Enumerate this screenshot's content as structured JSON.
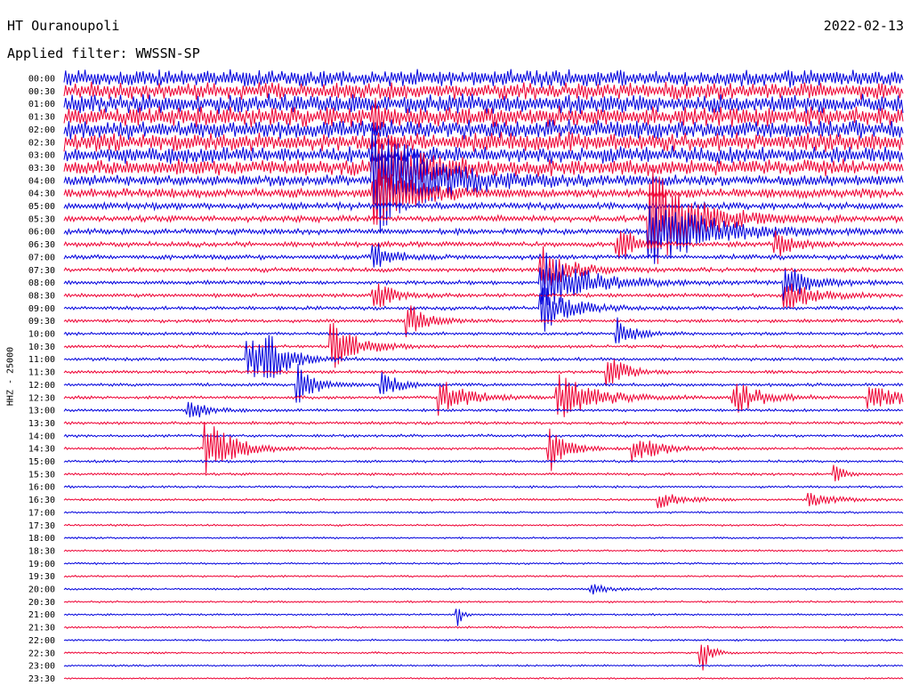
{
  "header": {
    "station": "HT Ouranoupoli",
    "date": "2022-02-13",
    "filter": "Applied filter: WWSSN-SP"
  },
  "channel_label": "HHZ - 25000",
  "colors": {
    "trace_a": "#0000dd",
    "trace_b": "#ee0033"
  },
  "chart_data": {
    "type": "line",
    "title": "HT Ouranoupoli",
    "subtitle": "Applied filter: WWSSN-SP",
    "ylabel": "HHZ - 25000",
    "time_labels": [
      "00:00",
      "00:30",
      "01:00",
      "01:30",
      "02:00",
      "02:30",
      "03:00",
      "03:30",
      "04:00",
      "04:30",
      "05:00",
      "05:30",
      "06:00",
      "06:30",
      "07:00",
      "07:30",
      "08:00",
      "08:30",
      "09:00",
      "09:30",
      "10:00",
      "10:30",
      "11:00",
      "11:30",
      "12:00",
      "12:30",
      "13:00",
      "13:30",
      "14:00",
      "14:30",
      "15:00",
      "15:30",
      "16:00",
      "16:30",
      "17:00",
      "17:30",
      "18:00",
      "18:30",
      "19:00",
      "19:30",
      "20:00",
      "20:30",
      "21:00",
      "21:30",
      "22:00",
      "22:30",
      "23:00",
      "23:30"
    ],
    "noise_level": [
      0.55,
      0.55,
      0.6,
      0.65,
      0.6,
      0.6,
      0.55,
      0.5,
      0.35,
      0.3,
      0.22,
      0.2,
      0.18,
      0.16,
      0.15,
      0.14,
      0.13,
      0.12,
      0.12,
      0.11,
      0.1,
      0.1,
      0.1,
      0.1,
      0.1,
      0.1,
      0.09,
      0.09,
      0.09,
      0.08,
      0.08,
      0.08,
      0.07,
      0.07,
      0.06,
      0.06,
      0.06,
      0.06,
      0.06,
      0.06,
      0.06,
      0.06,
      0.06,
      0.06,
      0.06,
      0.06,
      0.06,
      0.05
    ],
    "events": [
      {
        "row": 3,
        "x": 0.37,
        "amp": 1.2,
        "dur": 0.01
      },
      {
        "row": 7,
        "x": 0.37,
        "amp": 2.5,
        "dur": 0.05
      },
      {
        "row": 8,
        "x": 0.37,
        "amp": 4.5,
        "dur": 0.06
      },
      {
        "row": 9,
        "x": 0.37,
        "amp": 2.5,
        "dur": 0.04
      },
      {
        "row": 11,
        "x": 0.7,
        "amp": 4.0,
        "dur": 0.05
      },
      {
        "row": 12,
        "x": 0.7,
        "amp": 3.0,
        "dur": 0.06
      },
      {
        "row": 13,
        "x": 0.66,
        "amp": 1.5,
        "dur": 0.02
      },
      {
        "row": 13,
        "x": 0.85,
        "amp": 1.0,
        "dur": 0.02
      },
      {
        "row": 14,
        "x": 0.37,
        "amp": 1.2,
        "dur": 0.02
      },
      {
        "row": 15,
        "x": 0.57,
        "amp": 2.0,
        "dur": 0.03
      },
      {
        "row": 16,
        "x": 0.57,
        "amp": 2.5,
        "dur": 0.05
      },
      {
        "row": 16,
        "x": 0.86,
        "amp": 1.5,
        "dur": 0.03
      },
      {
        "row": 17,
        "x": 0.86,
        "amp": 1.3,
        "dur": 0.03
      },
      {
        "row": 17,
        "x": 0.37,
        "amp": 1.2,
        "dur": 0.02
      },
      {
        "row": 18,
        "x": 0.57,
        "amp": 2.0,
        "dur": 0.03
      },
      {
        "row": 19,
        "x": 0.41,
        "amp": 1.5,
        "dur": 0.02
      },
      {
        "row": 20,
        "x": 0.66,
        "amp": 1.2,
        "dur": 0.02
      },
      {
        "row": 21,
        "x": 0.32,
        "amp": 1.8,
        "dur": 0.03
      },
      {
        "row": 22,
        "x": 0.22,
        "amp": 1.8,
        "dur": 0.03
      },
      {
        "row": 22,
        "x": 0.24,
        "amp": 1.6,
        "dur": 0.02
      },
      {
        "row": 23,
        "x": 0.65,
        "amp": 1.3,
        "dur": 0.02
      },
      {
        "row": 24,
        "x": 0.28,
        "amp": 1.5,
        "dur": 0.02
      },
      {
        "row": 24,
        "x": 0.38,
        "amp": 1.0,
        "dur": 0.02
      },
      {
        "row": 25,
        "x": 0.45,
        "amp": 1.6,
        "dur": 0.03
      },
      {
        "row": 25,
        "x": 0.59,
        "amp": 2.0,
        "dur": 0.04
      },
      {
        "row": 25,
        "x": 0.8,
        "amp": 1.3,
        "dur": 0.03
      },
      {
        "row": 25,
        "x": 0.96,
        "amp": 0.8,
        "dur": 0.05
      },
      {
        "row": 26,
        "x": 0.15,
        "amp": 0.8,
        "dur": 0.02
      },
      {
        "row": 29,
        "x": 0.17,
        "amp": 2.5,
        "dur": 0.03
      },
      {
        "row": 29,
        "x": 0.58,
        "amp": 1.8,
        "dur": 0.02
      },
      {
        "row": 29,
        "x": 0.68,
        "amp": 1.2,
        "dur": 0.03
      },
      {
        "row": 31,
        "x": 0.92,
        "amp": 0.8,
        "dur": 0.01
      },
      {
        "row": 33,
        "x": 0.71,
        "amp": 0.6,
        "dur": 0.03
      },
      {
        "row": 33,
        "x": 0.89,
        "amp": 0.5,
        "dur": 0.03
      },
      {
        "row": 40,
        "x": 0.63,
        "amp": 0.4,
        "dur": 0.02
      },
      {
        "row": 42,
        "x": 0.47,
        "amp": 1.0,
        "dur": 0.005
      },
      {
        "row": 45,
        "x": 0.76,
        "amp": 1.6,
        "dur": 0.01
      }
    ],
    "grid": false
  }
}
